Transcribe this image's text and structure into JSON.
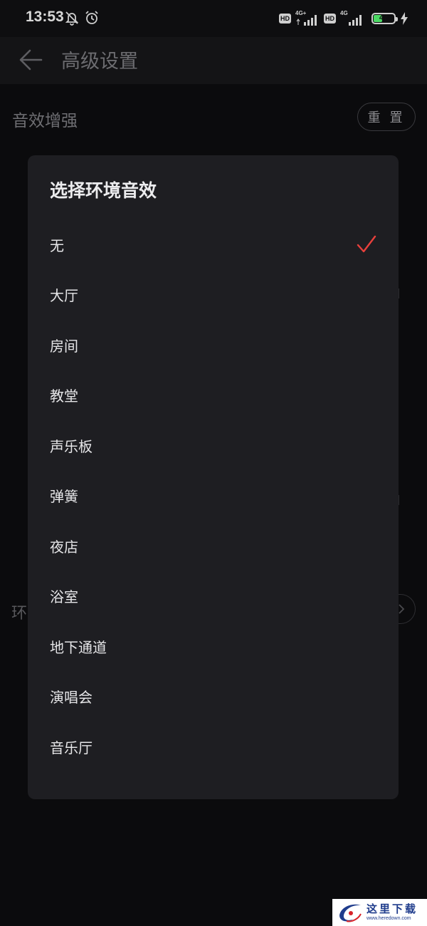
{
  "status_bar": {
    "time": "13:53",
    "network1": "4G+",
    "network2": "4G",
    "hd_label": "HD",
    "battery_level": "47",
    "battery_fraction": 0.47,
    "battery_color": "#4cd964"
  },
  "header": {
    "title": "高级设置",
    "back_icon": "arrow-left-icon"
  },
  "background": {
    "section_title": "音效增强",
    "reset_label": "重 置",
    "env_label": "环"
  },
  "dialog": {
    "title": "选择环境音效",
    "selected_index": 0,
    "check_color": "#e8403c",
    "options": [
      {
        "label": "无"
      },
      {
        "label": "大厅"
      },
      {
        "label": "房间"
      },
      {
        "label": "教堂"
      },
      {
        "label": "声乐板"
      },
      {
        "label": "弹簧"
      },
      {
        "label": "夜店"
      },
      {
        "label": "浴室"
      },
      {
        "label": "地下通道"
      },
      {
        "label": "演唱会"
      },
      {
        "label": "音乐厅"
      }
    ]
  },
  "watermark": {
    "text": "这里下载",
    "url": "www.heredown.com"
  }
}
